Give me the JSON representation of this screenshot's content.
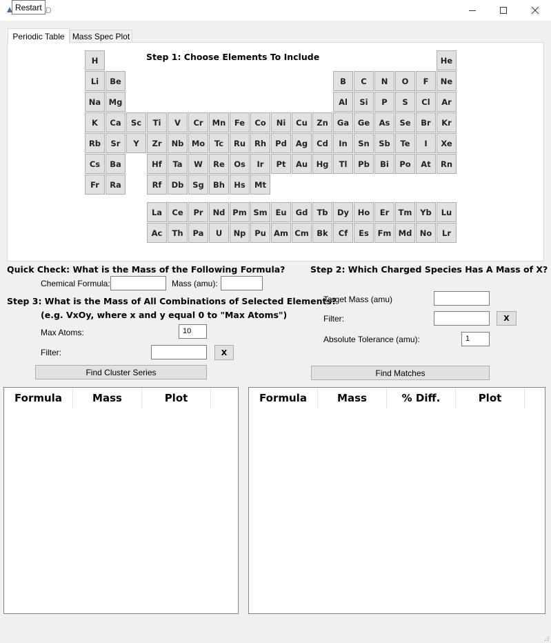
{
  "window": {
    "title_partial": "D",
    "tooltip": "Restart"
  },
  "tabs": [
    "Periodic Table",
    "Mass Spec Plot"
  ],
  "step1_title": "Step 1: Choose Elements To Include",
  "elements": {
    "row1": [
      "H",
      "He"
    ],
    "row2": [
      "Li",
      "Be",
      "B",
      "C",
      "N",
      "O",
      "F",
      "Ne"
    ],
    "row3": [
      "Na",
      "Mg",
      "Al",
      "Si",
      "P",
      "S",
      "Cl",
      "Ar"
    ],
    "row4": [
      "K",
      "Ca",
      "Sc",
      "Ti",
      "V",
      "Cr",
      "Mn",
      "Fe",
      "Co",
      "Ni",
      "Cu",
      "Zn",
      "Ga",
      "Ge",
      "As",
      "Se",
      "Br",
      "Kr"
    ],
    "row5": [
      "Rb",
      "Sr",
      "Y",
      "Zr",
      "Nb",
      "Mo",
      "Tc",
      "Ru",
      "Rh",
      "Pd",
      "Ag",
      "Cd",
      "In",
      "Sn",
      "Sb",
      "Te",
      "I",
      "Xe"
    ],
    "row6": [
      "Cs",
      "Ba",
      "Hf",
      "Ta",
      "W",
      "Re",
      "Os",
      "Ir",
      "Pt",
      "Au",
      "Hg",
      "Tl",
      "Pb",
      "Bi",
      "Po",
      "At",
      "Rn"
    ],
    "row7": [
      "Fr",
      "Ra",
      "Rf",
      "Db",
      "Sg",
      "Bh",
      "Hs",
      "Mt"
    ],
    "lanthanides": [
      "La",
      "Ce",
      "Pr",
      "Nd",
      "Pm",
      "Sm",
      "Eu",
      "Gd",
      "Tb",
      "Dy",
      "Ho",
      "Er",
      "Tm",
      "Yb",
      "Lu"
    ],
    "actinides": [
      "Ac",
      "Th",
      "Pa",
      "U",
      "Np",
      "Pu",
      "Am",
      "Cm",
      "Bk",
      "Cf",
      "Es",
      "Fm",
      "Md",
      "No",
      "Lr"
    ]
  },
  "quick_check": {
    "title": "Quick Check: What is the Mass of the Following Formula?",
    "formula_label": "Chemical Formula:",
    "formula_value": "",
    "mass_label": "Mass (amu):",
    "mass_value": ""
  },
  "step3": {
    "title": "Step 3: What is the Mass of All Combinations of Selected Elements?",
    "subtitle": "(e.g. VxOy, where x and y equal 0 to \"Max Atoms\")",
    "max_atoms_label": "Max Atoms:",
    "max_atoms_value": "10",
    "filter_label": "Filter:",
    "filter_value": "",
    "clear_label": "X",
    "find_button": "Find Cluster Series"
  },
  "step2": {
    "title": "Step 2: Which Charged Species Has A Mass of X?",
    "target_label": "Target Mass (amu)",
    "target_value": "",
    "filter_label": "Filter:",
    "filter_value": "",
    "clear_label": "X",
    "tolerance_label": "Absolute Tolerance (amu):",
    "tolerance_value": "1",
    "find_button": "Find Matches"
  },
  "left_table": {
    "columns": [
      "Formula",
      "Mass",
      "Plot"
    ]
  },
  "right_table": {
    "columns": [
      "Formula",
      "Mass",
      "% Diff.",
      "Plot"
    ]
  }
}
